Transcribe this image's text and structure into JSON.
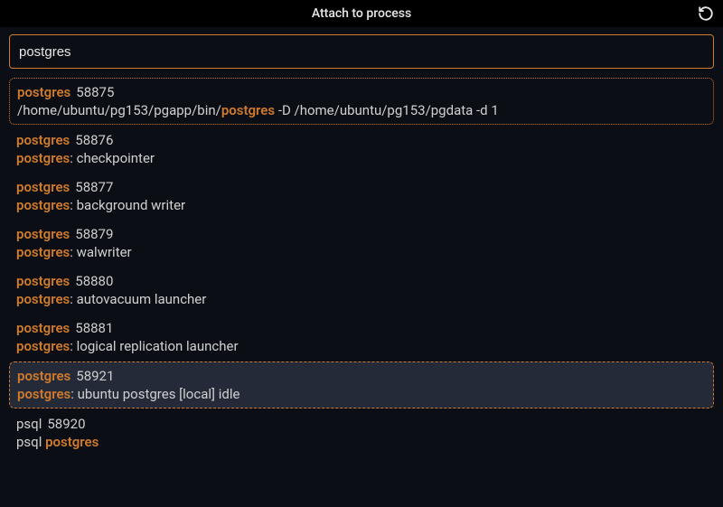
{
  "titlebar": {
    "title": "Attach to process"
  },
  "search": {
    "value": "postgres"
  },
  "processes": [
    {
      "name": "postgres",
      "pid": "58875",
      "detail_prefix": "/home/ubuntu/pg153/pgapp/bin/",
      "detail_hl": "postgres",
      "detail_suffix": " -D /home/ubuntu/pg153/pgdata -d 1",
      "state": "selected"
    },
    {
      "name": "postgres",
      "pid": "58876",
      "detail_prefix": "",
      "detail_hl": "postgres",
      "detail_suffix": ": checkpointer",
      "state": "normal"
    },
    {
      "name": "postgres",
      "pid": "58877",
      "detail_prefix": "",
      "detail_hl": "postgres",
      "detail_suffix": ": background writer",
      "state": "normal"
    },
    {
      "name": "postgres",
      "pid": "58879",
      "detail_prefix": "",
      "detail_hl": "postgres",
      "detail_suffix": ": walwriter",
      "state": "normal"
    },
    {
      "name": "postgres",
      "pid": "58880",
      "detail_prefix": "",
      "detail_hl": "postgres",
      "detail_suffix": ": autovacuum launcher",
      "state": "normal"
    },
    {
      "name": "postgres",
      "pid": "58881",
      "detail_prefix": "",
      "detail_hl": "postgres",
      "detail_suffix": ": logical replication launcher",
      "state": "normal"
    },
    {
      "name": "postgres",
      "pid": "58921",
      "detail_prefix": "",
      "detail_hl": "postgres",
      "detail_suffix": ": ubuntu postgres [local] idle",
      "state": "hovered"
    },
    {
      "name": "psql",
      "pid": "58920",
      "detail_prefix": "psql ",
      "detail_hl": "postgres",
      "detail_suffix": "",
      "state": "normal",
      "name_highlight": false
    }
  ]
}
